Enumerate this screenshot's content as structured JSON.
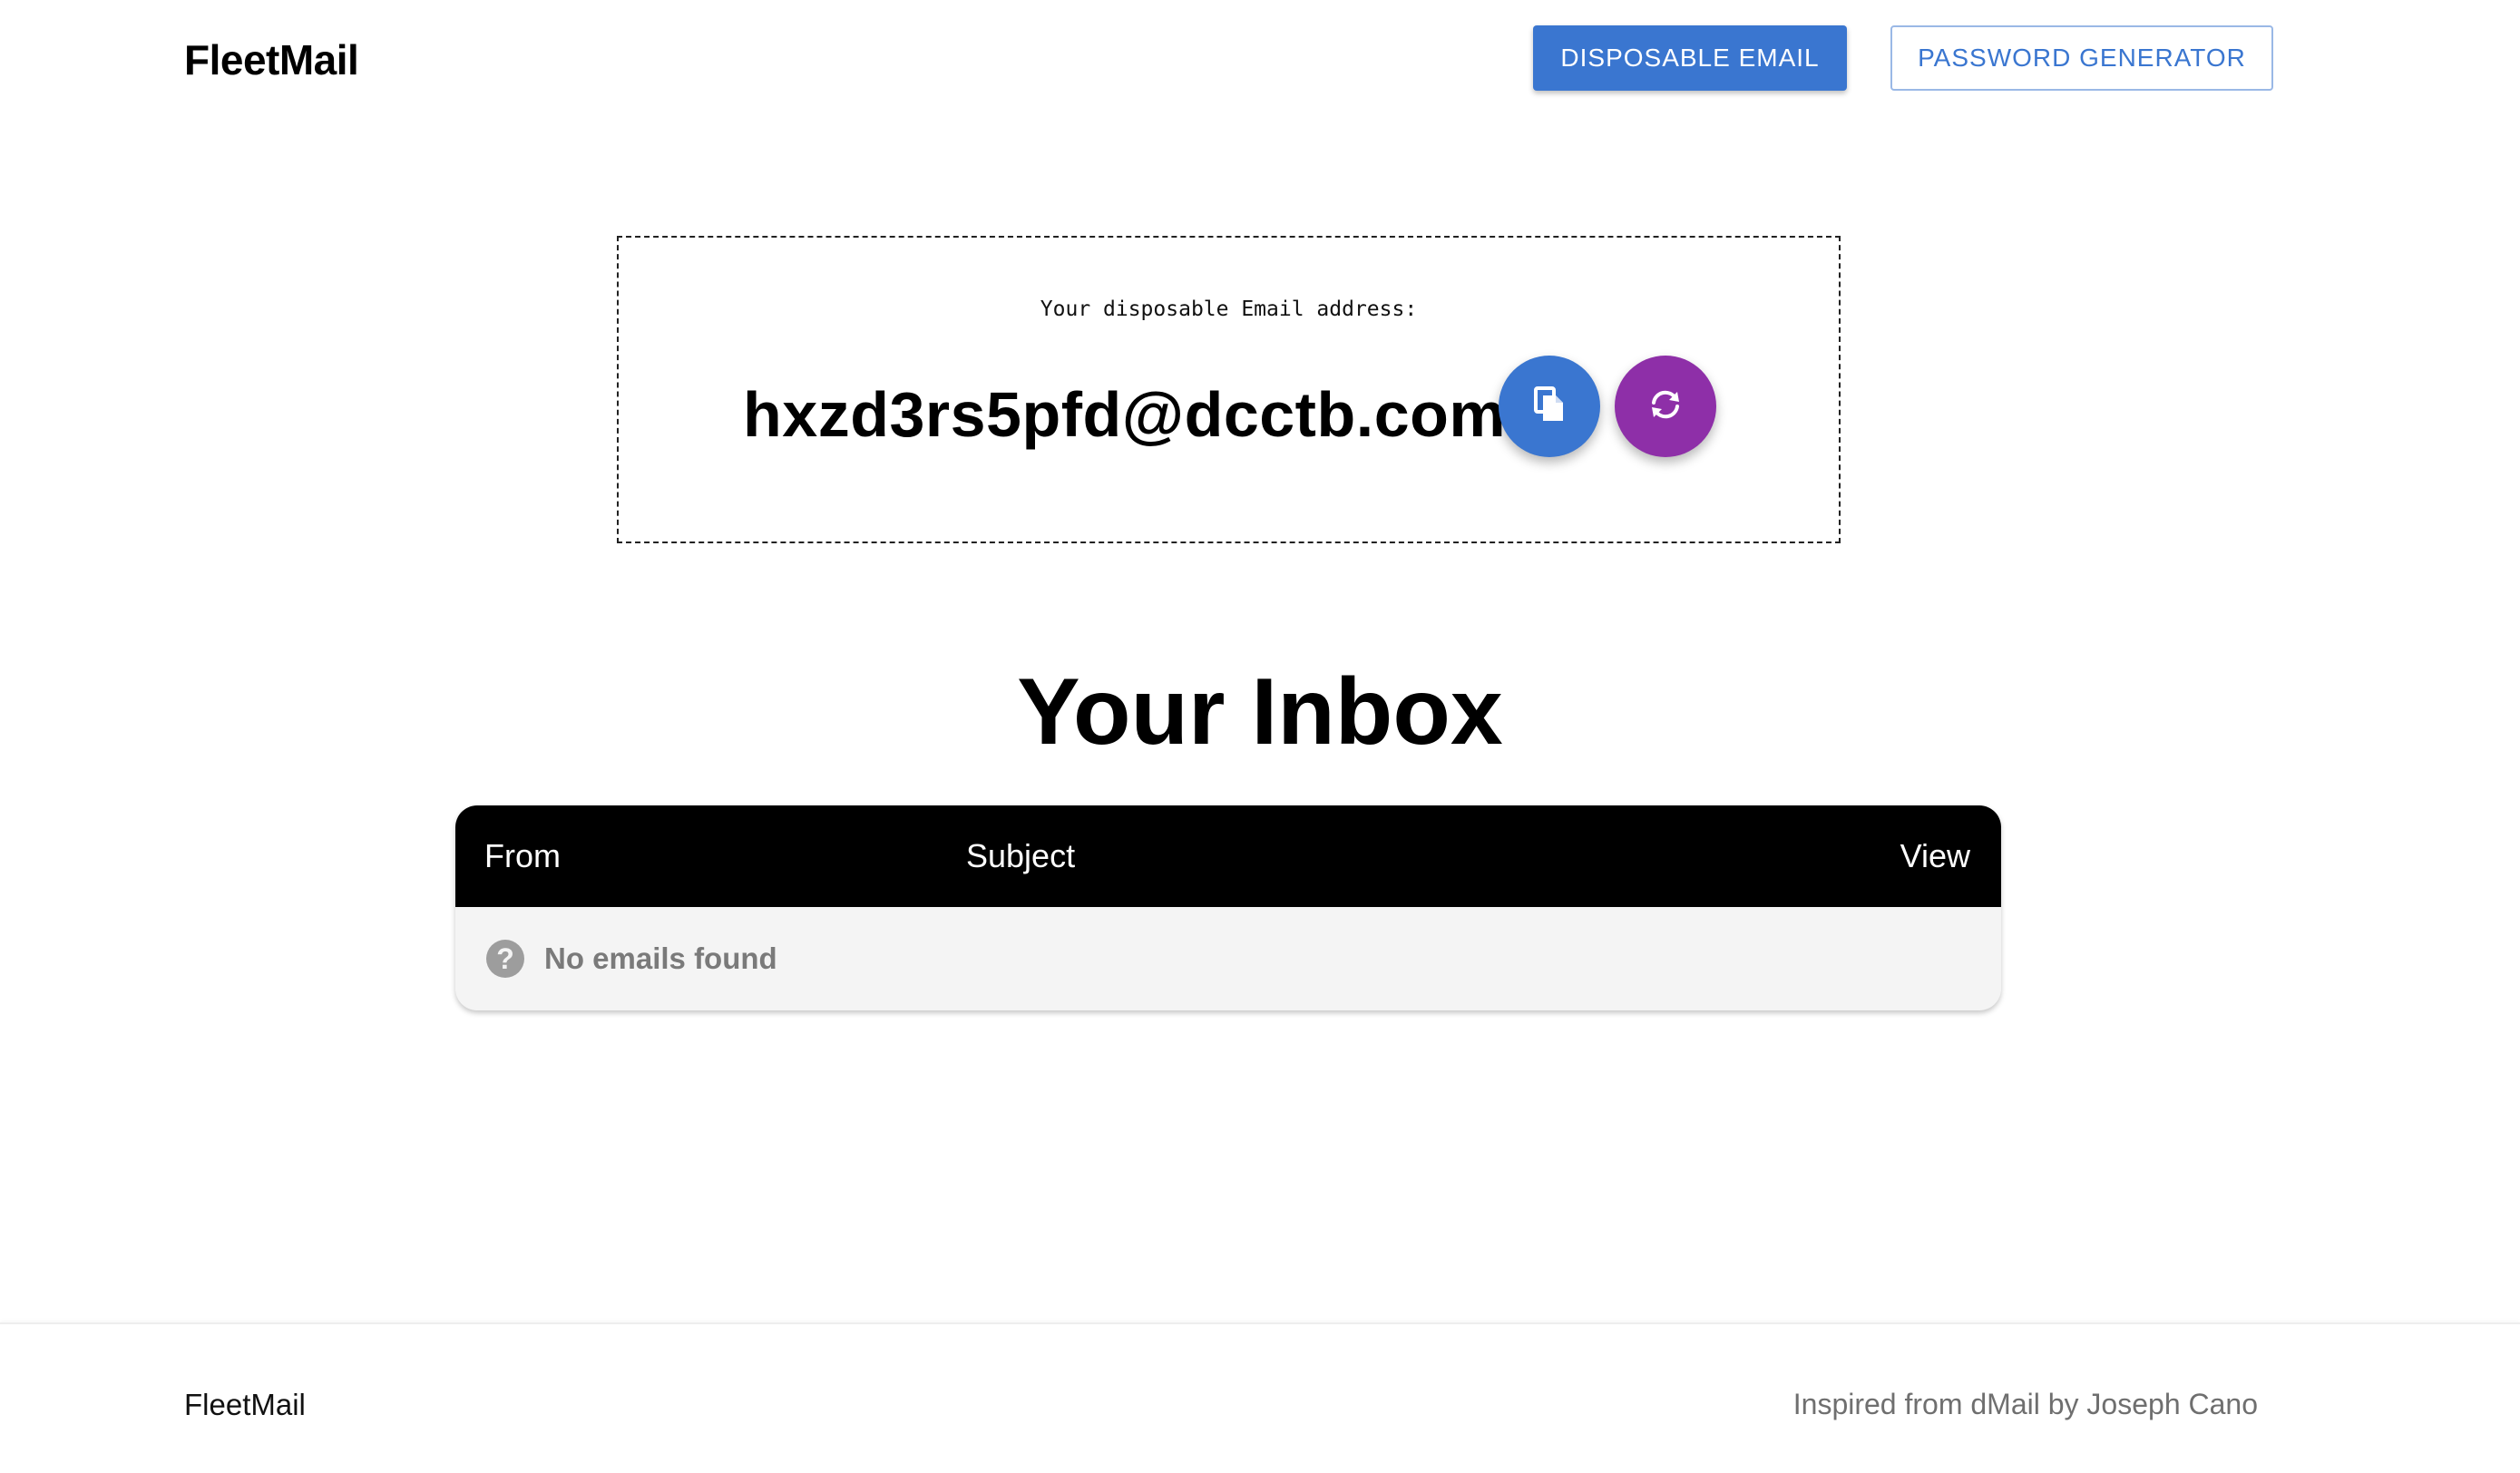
{
  "header": {
    "brand": "FleetMail",
    "nav": {
      "disposable_email": "DISPOSABLE EMAIL",
      "password_generator": "PASSWORD GENERATOR"
    }
  },
  "email_panel": {
    "caption": "Your disposable Email address:",
    "address": "hxzd3rs5pfd@dcctb.com",
    "copy_icon": "copy-icon",
    "refresh_icon": "refresh-icon"
  },
  "inbox": {
    "title": "Your Inbox",
    "columns": {
      "from": "From",
      "subject": "Subject",
      "view": "View"
    },
    "empty_message": "No emails found",
    "empty_icon": "help-circle-icon"
  },
  "footer": {
    "brand": "FleetMail",
    "credit": "Inspired from dMail by Joseph Cano"
  },
  "colors": {
    "primary": "#3a76d0",
    "refresh": "#8e2fa8",
    "table_header": "#000000",
    "table_body": "#f4f4f4"
  }
}
